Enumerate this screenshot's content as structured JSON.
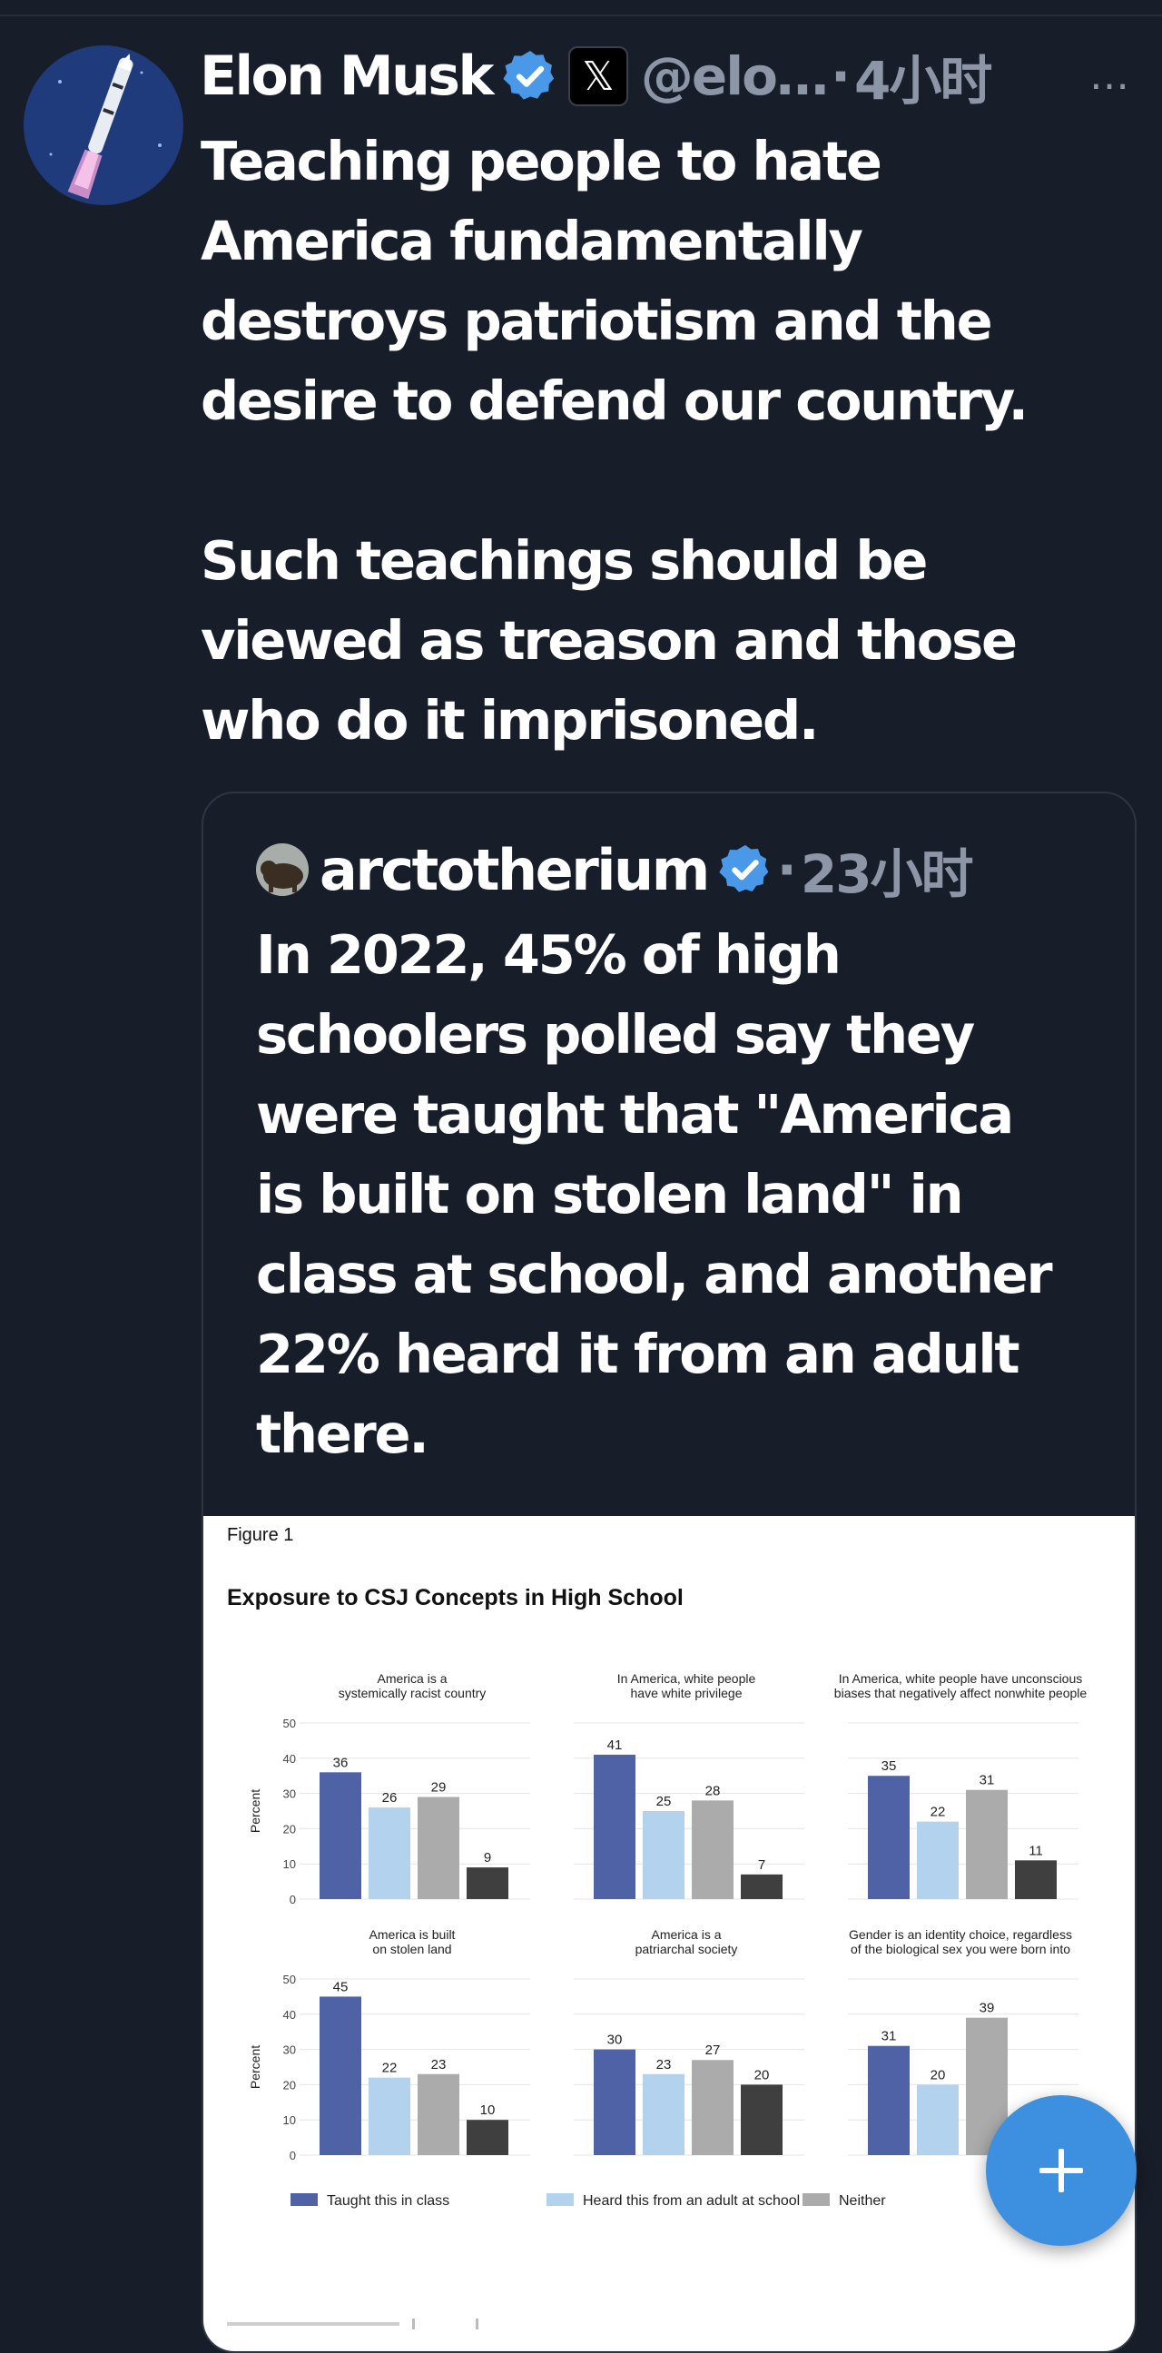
{
  "tweet": {
    "author_name": "Elon Musk",
    "x_badge": "𝕏",
    "handle": "@elo…",
    "separator": "·",
    "timestamp": "4小时",
    "more_icon": "…",
    "text": "Teaching people to hate\nAmerica fundamentally\ndestroys patriotism and the\ndesire to defend our country.\n\nSuch teachings should be\nviewed as treason and those\nwho do it imprisoned."
  },
  "quoted_tweet": {
    "author_name": "arctotherium",
    "separator": "·",
    "timestamp": "23小时",
    "text": "In 2022, 45% of high\nschoolers polled say they\nwere taught that \"America\nis built on stolen land\" in\nclass at school, and another\n22% heard it from an adult\nthere."
  },
  "colors": {
    "background": "#171d29",
    "verified_blue": "#4a99e9",
    "fab_blue": "#3d8fe0",
    "muted_text": "#8d96a6"
  },
  "fab": {
    "icon": "plus-icon"
  },
  "chart_data": {
    "type": "bar",
    "figure_label": "Figure 1",
    "title": "Exposure to CSJ Concepts in High School",
    "ylabel": "Percent",
    "ylim": [
      0,
      50
    ],
    "yticks": [
      0,
      10,
      20,
      30,
      40,
      50
    ],
    "series_names": [
      "Taught this in class",
      "Heard this from an adult at school",
      "Neither",
      ""
    ],
    "series_colors": [
      "#4f62a6",
      "#b2d2ee",
      "#ababab",
      "#3f3f3f"
    ],
    "panels": [
      {
        "title_lines": [
          "America is a",
          "systemically racist country"
        ],
        "values": [
          36,
          26,
          29,
          9
        ]
      },
      {
        "title_lines": [
          "In America, white people",
          "have white privilege"
        ],
        "values": [
          41,
          25,
          28,
          7
        ]
      },
      {
        "title_lines": [
          "In America, white people have unconscious",
          "biases that negatively affect nonwhite people"
        ],
        "values": [
          35,
          22,
          31,
          11
        ]
      },
      {
        "title_lines": [
          "America is built",
          "on stolen land"
        ],
        "values": [
          45,
          22,
          23,
          10
        ]
      },
      {
        "title_lines": [
          "America is a",
          "patriarchal society"
        ],
        "values": [
          30,
          23,
          27,
          20
        ]
      },
      {
        "title_lines": [
          "Gender is an identity choice, regardless",
          "of the biological sex you were born into"
        ],
        "values": [
          31,
          20,
          39,
          null
        ]
      }
    ]
  }
}
